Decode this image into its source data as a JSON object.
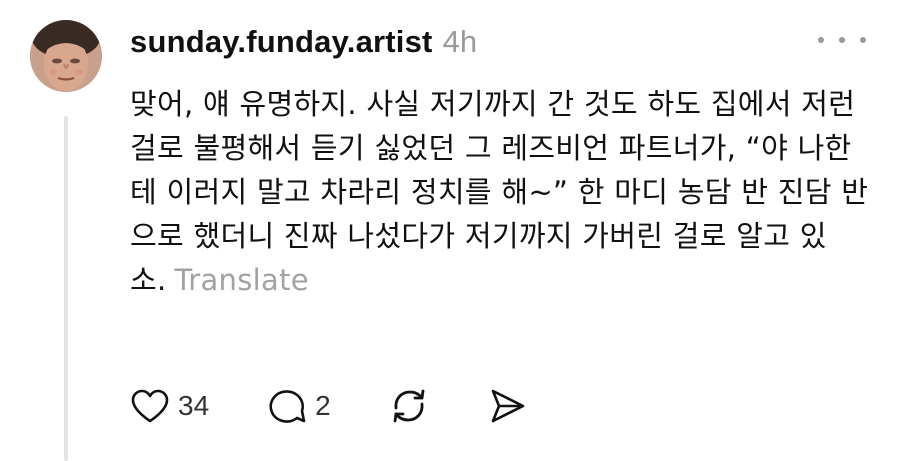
{
  "post": {
    "username": "sunday.funday.artist",
    "time_ago": "4h",
    "text": "맞어, 얘 유명하지. 사실 저기까지 간 것도 하도 집에서 저런 걸로 불평해서 듣기 싫었던 그 레즈비언 파트너가, “야 나한테 이러지 말고 차라리 정치를 해~” 한 마디 농담 반 진담 반으로 했더니 진짜 나섰다가 저기까지 가버린 걸로 알고 있소.",
    "translate_label": "Translate"
  },
  "actions": {
    "like_count": "34",
    "reply_count": "2"
  },
  "icons": {
    "more": "more-icon",
    "like": "heart-icon",
    "reply": "comment-icon",
    "repost": "repost-icon",
    "share": "send-icon"
  },
  "colors": {
    "text": "#111111",
    "muted": "#9a9a9a",
    "thread_line": "#e4e4e4"
  }
}
